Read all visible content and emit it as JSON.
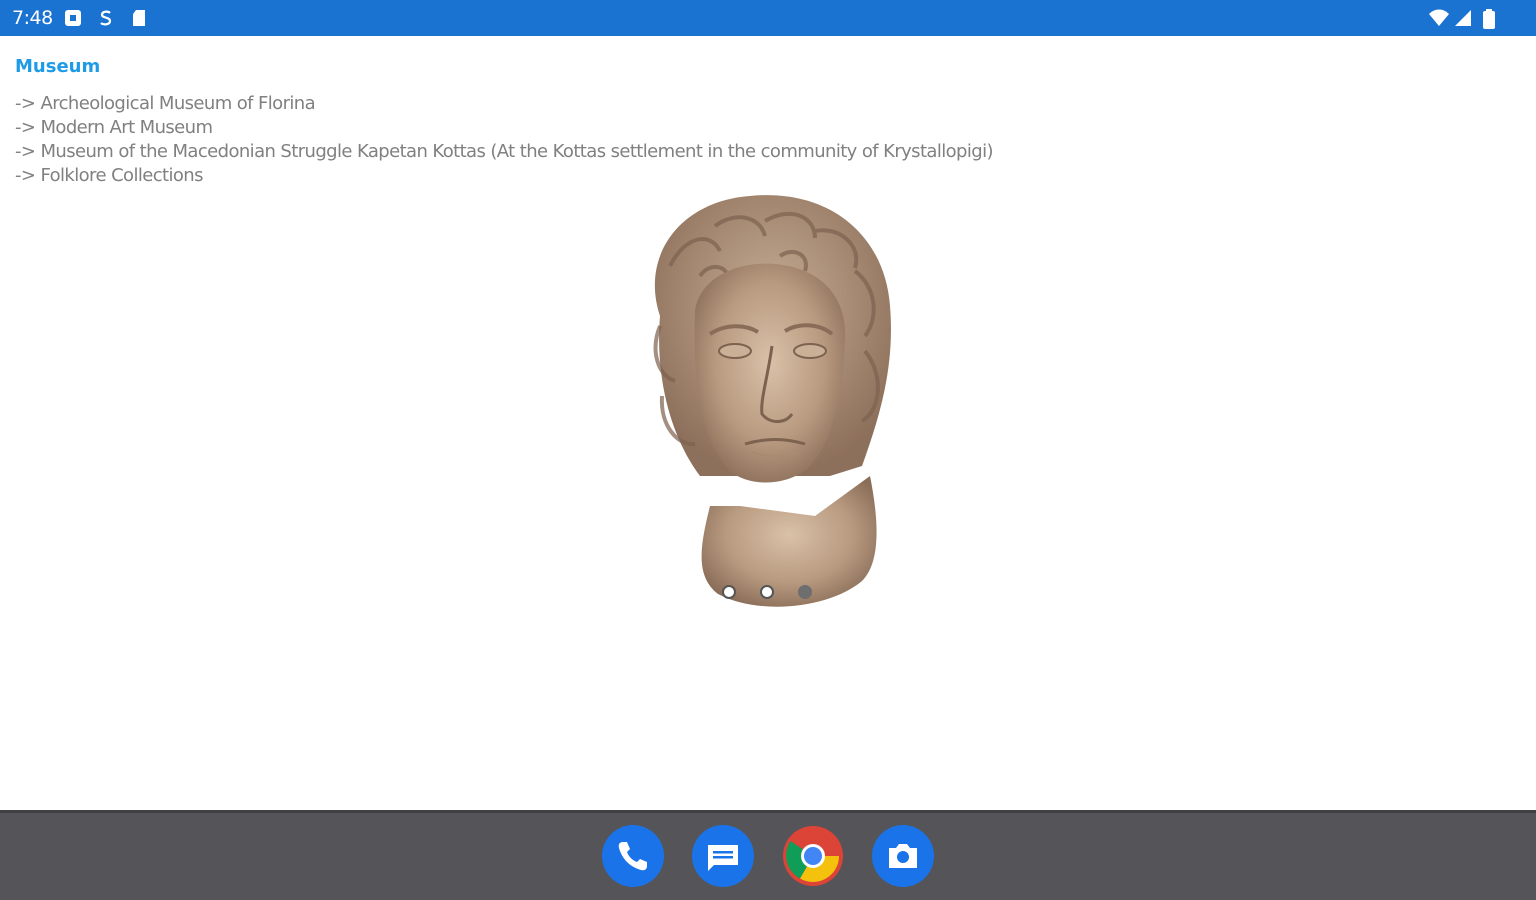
{
  "status_bar": {
    "time": "7:48",
    "left_icons": [
      "notification-square-icon",
      "s-icon",
      "sd-card-icon"
    ],
    "right_icons": [
      "wifi-icon",
      "signal-icon",
      "battery-icon"
    ],
    "background": "#1a73d0"
  },
  "content": {
    "section_title": "Museum",
    "title_color": "#1e9be6",
    "items": [
      "->  Archeological Museum of Florina",
      "->  Modern Art Museum",
      "->  Museum of the Macedonian Struggle Kapetan Kottas (At the Kottas settlement in the  community of Krystallopigi)",
      "-> Folklore Collections"
    ],
    "carousel": {
      "image": "marble-bust-image",
      "pages": 3,
      "active_page": 3
    }
  },
  "taskbar": {
    "apps": [
      "phone-icon",
      "messages-icon",
      "chrome-icon",
      "camera-icon"
    ],
    "background": "#545459"
  }
}
